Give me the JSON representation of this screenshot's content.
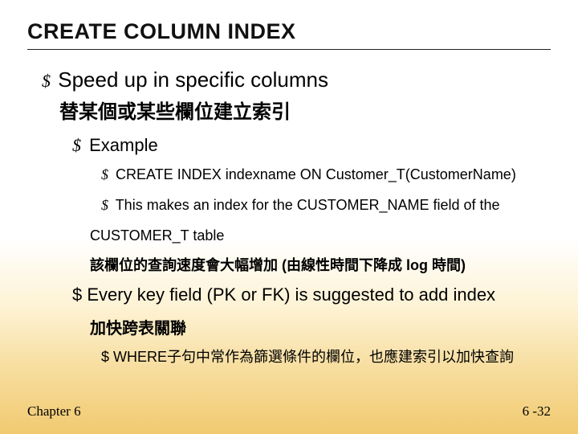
{
  "title": "CREATE COLUMN INDEX",
  "bullets": {
    "l1": "Speed up in specific columns",
    "l1_sub": "替某個或某些欄位建立索引",
    "l2_example": "Example",
    "l3_create": "CREATE INDEX indexname ON Customer_T(CustomerName)",
    "l3_this": "This makes an index for the CUSTOMER_NAME field of the",
    "l3_this_cont": "CUSTOMER_T table",
    "l3_zh_bold": "該欄位的查詢速度會大幅增加 (由線性時間下降成 log 時間)",
    "l2_every": "Every key field (PK or FK) is suggested to add index",
    "l2_every_sub": "加快跨表關聯",
    "l3_where": "WHERE子句中常作為篩選條件的欄位，也應建索引以加快查詢"
  },
  "footer": {
    "left": "Chapter 6",
    "right": "6 -32"
  }
}
